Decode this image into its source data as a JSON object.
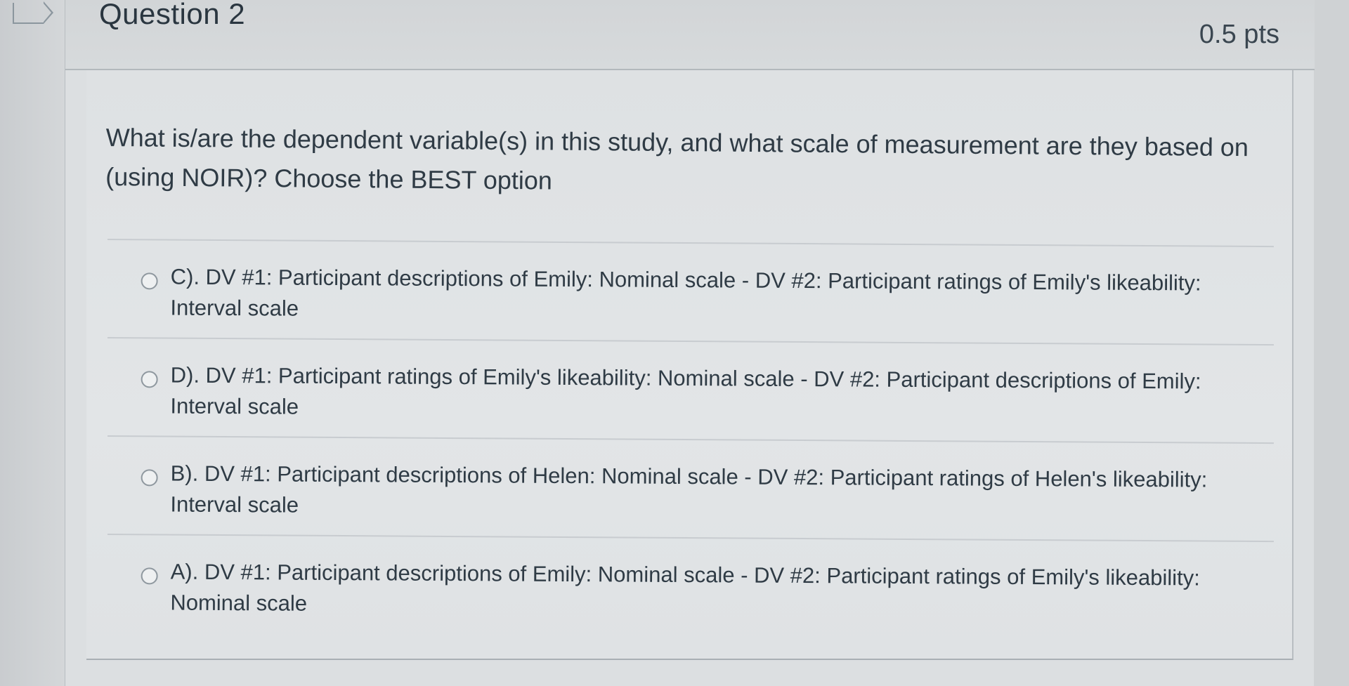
{
  "question": {
    "title": "Question 2",
    "points": "0.5 pts",
    "text": "What is/are the dependent variable(s) in this study, and what scale of measurement are they based on (using NOIR)? Choose the BEST option"
  },
  "answers": [
    {
      "label": "C). DV #1: Participant descriptions of Emily: Nominal scale - DV #2: Participant ratings of Emily's likeability: Interval scale"
    },
    {
      "label": "D). DV #1: Participant ratings of Emily's likeability: Nominal scale - DV #2: Participant descriptions of Emily: Interval scale"
    },
    {
      "label": "B). DV #1: Participant descriptions of Helen: Nominal scale - DV #2: Participant ratings of Helen's likeability: Interval scale"
    },
    {
      "label": "A). DV #1: Participant descriptions of Emily: Nominal scale - DV #2: Participant ratings of Emily's likeability: Nominal scale"
    }
  ],
  "icons": {
    "bookmark": "bookmark-flag-icon",
    "radio": "radio-button-unselected"
  },
  "colors": {
    "background": "#cfd2d4",
    "card": "#dcdfe1",
    "text": "#2d3b45",
    "border": "#b3b8bc"
  }
}
